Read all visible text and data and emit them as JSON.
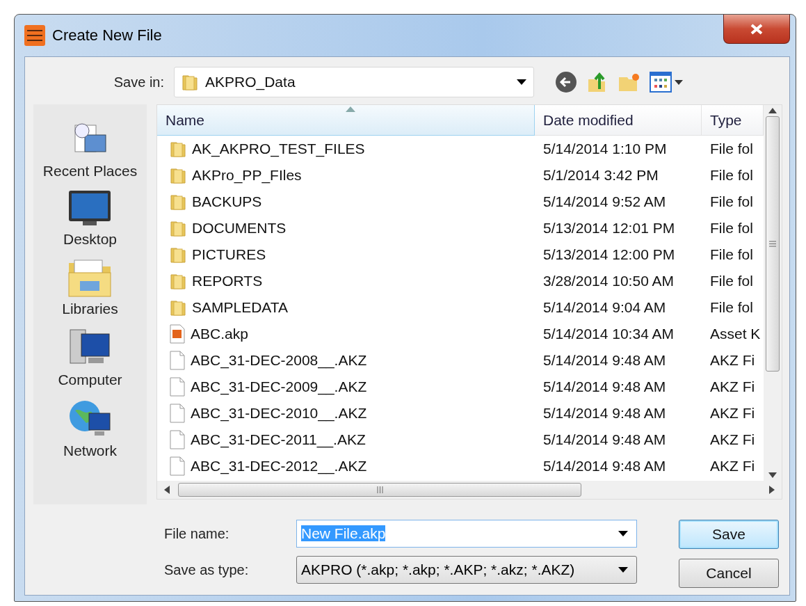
{
  "window": {
    "title": "Create New File"
  },
  "save_in": {
    "label": "Save in:",
    "value": "AKPRO_Data"
  },
  "places": [
    {
      "label": "Recent Places",
      "kind": "recent"
    },
    {
      "label": "Desktop",
      "kind": "desktop"
    },
    {
      "label": "Libraries",
      "kind": "libraries"
    },
    {
      "label": "Computer",
      "kind": "computer"
    },
    {
      "label": "Network",
      "kind": "network"
    }
  ],
  "columns": [
    {
      "label": "Name",
      "sorted": true
    },
    {
      "label": "Date modified",
      "sorted": false
    },
    {
      "label": "Type",
      "sorted": false
    }
  ],
  "rows": [
    {
      "name": "AK_AKPRO_TEST_FILES",
      "date": "5/14/2014 1:10 PM",
      "type": "File fol",
      "kind": "folder"
    },
    {
      "name": "AKPro_PP_FIles",
      "date": "5/1/2014 3:42 PM",
      "type": "File fol",
      "kind": "folder"
    },
    {
      "name": "BACKUPS",
      "date": "5/14/2014 9:52 AM",
      "type": "File fol",
      "kind": "folder"
    },
    {
      "name": "DOCUMENTS",
      "date": "5/13/2014 12:01 PM",
      "type": "File fol",
      "kind": "folder"
    },
    {
      "name": "PICTURES",
      "date": "5/13/2014 12:00 PM",
      "type": "File fol",
      "kind": "folder"
    },
    {
      "name": "REPORTS",
      "date": "3/28/2014 10:50 AM",
      "type": "File fol",
      "kind": "folder"
    },
    {
      "name": "SAMPLEDATA",
      "date": "5/14/2014 9:04 AM",
      "type": "File fol",
      "kind": "folder"
    },
    {
      "name": "ABC.akp",
      "date": "5/14/2014 10:34 AM",
      "type": "Asset K",
      "kind": "akp"
    },
    {
      "name": "ABC_31-DEC-2008__.AKZ",
      "date": "5/14/2014 9:48 AM",
      "type": "AKZ Fi",
      "kind": "file"
    },
    {
      "name": "ABC_31-DEC-2009__.AKZ",
      "date": "5/14/2014 9:48 AM",
      "type": "AKZ Fi",
      "kind": "file"
    },
    {
      "name": "ABC_31-DEC-2010__.AKZ",
      "date": "5/14/2014 9:48 AM",
      "type": "AKZ Fi",
      "kind": "file"
    },
    {
      "name": "ABC_31-DEC-2011__.AKZ",
      "date": "5/14/2014 9:48 AM",
      "type": "AKZ Fi",
      "kind": "file"
    },
    {
      "name": "ABC_31-DEC-2012__.AKZ",
      "date": "5/14/2014 9:48 AM",
      "type": "AKZ Fi",
      "kind": "file"
    }
  ],
  "file_name": {
    "label": "File name:",
    "value": "New File.akp"
  },
  "save_as_type": {
    "label": "Save as type:",
    "value": "AKPRO (*.akp; *.akp; *.AKP; *.akz; *.AKZ)"
  },
  "buttons": [
    "Save",
    "Cancel"
  ]
}
